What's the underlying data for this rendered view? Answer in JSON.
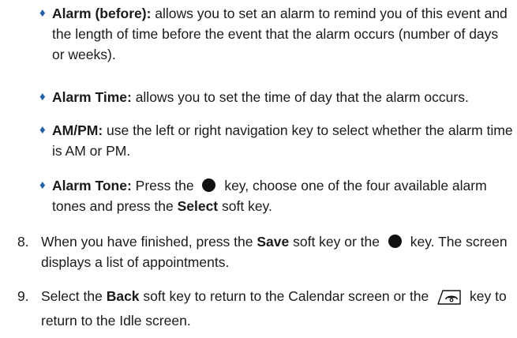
{
  "bullets": [
    {
      "label": "Alarm (before):",
      "text": " allows you to set an alarm to remind you of this event and the length of time before the event that the alarm occurs (number of days or weeks)."
    },
    {
      "label": "Alarm Time:",
      "text": " allows you to set the time of day that the alarm occurs."
    },
    {
      "label": "AM/PM:",
      "text": " use the left or right navigation key to select whether the alarm time is AM or PM."
    },
    {
      "label": "Alarm Tone:",
      "text_a": " Press the ",
      "text_b": " key, choose one of the four available alarm tones and press the ",
      "bold": "Select",
      "text_c": " soft key."
    }
  ],
  "steps": [
    {
      "number": "8.",
      "text_a": "When you have finished, press the ",
      "bold": "Save",
      "text_b": " soft key or the ",
      "text_c": " key. The screen displays a list of appointments."
    },
    {
      "number": "9.",
      "text_a": "Select the ",
      "bold": "Back",
      "text_b": " soft key to return to the Calendar screen or the ",
      "text_c": " key to return to the Idle screen."
    }
  ],
  "bullet_glyph": "♦",
  "colors": {
    "bullet": "#1f5fa8",
    "text": "#1a1a1a"
  },
  "icons": {
    "ok_key": "ok-key-icon",
    "end_key": "end-key-icon"
  }
}
